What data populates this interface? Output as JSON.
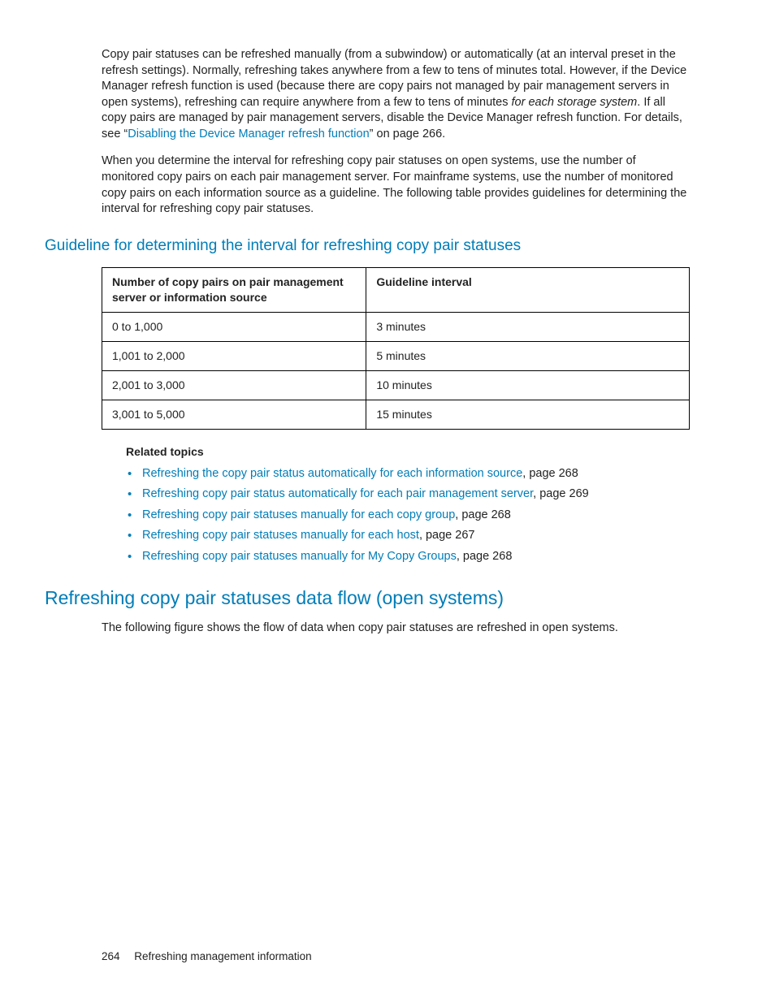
{
  "para1": {
    "t1": "Copy pair statuses can be refreshed manually (from a subwindow) or automatically (at an interval preset in the refresh settings). Normally, refreshing takes anywhere from a few to tens of minutes total. However, if the Device Manager refresh function is used (because there are copy pairs not managed by pair management servers in open systems), refreshing can require anywhere from a few to tens of minutes ",
    "italic": "for each storage system",
    "t2": ". If all copy pairs are managed by pair management servers, disable the Device Manager refresh function. For details, see “",
    "link": "Disabling the Device Manager refresh function",
    "t3": "” on page 266."
  },
  "para2": "When you determine the interval for refreshing copy pair statuses on open systems, use the number of monitored copy pairs on each pair management server. For mainframe systems, use the number of monitored copy pairs on each information source as a guideline. The following table provides guidelines for determining the interval for refreshing copy pair statuses.",
  "heading_guideline": "Guideline for determining the interval for refreshing copy pair statuses",
  "table": {
    "col1": "Number of copy pairs on pair management server or information source",
    "col2": "Guideline interval",
    "rows": [
      {
        "c1": "0 to 1,000",
        "c2": "3 minutes"
      },
      {
        "c1": "1,001 to 2,000",
        "c2": "5 minutes"
      },
      {
        "c1": "2,001 to 3,000",
        "c2": "10 minutes"
      },
      {
        "c1": "3,001 to 5,000",
        "c2": "15 minutes"
      }
    ]
  },
  "related_heading": "Related topics",
  "related": [
    {
      "link": "Refreshing the copy pair status automatically for each information source",
      "suffix": ", page 268"
    },
    {
      "link": "Refreshing copy pair status automatically for each pair management server",
      "suffix": ", page 269"
    },
    {
      "link": "Refreshing copy pair statuses manually for each copy group",
      "suffix": ", page 268"
    },
    {
      "link": "Refreshing copy pair statuses manually for each host",
      "suffix": ", page 267"
    },
    {
      "link": "Refreshing copy pair statuses manually for My Copy Groups",
      "suffix": ", page 268"
    }
  ],
  "heading_flow": "Refreshing copy pair statuses data flow (open systems)",
  "para_flow": "The following figure shows the flow of data when copy pair statuses are refreshed in open systems.",
  "footer": {
    "page": "264",
    "title": "Refreshing management information"
  }
}
